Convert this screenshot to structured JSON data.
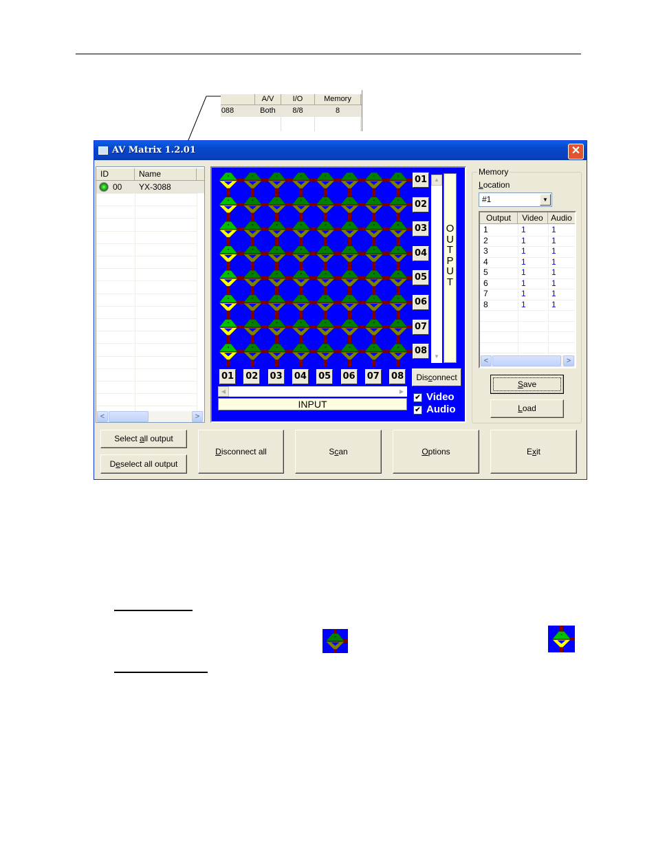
{
  "callout": {
    "columns": [
      "",
      "A/V",
      "I/O",
      "Memory"
    ],
    "row": [
      "088",
      "Both",
      "8/8",
      "8"
    ]
  },
  "window": {
    "title": "AV Matrix 1.2.01",
    "close_icon": "close-icon"
  },
  "device_list": {
    "columns": [
      "ID",
      "Name"
    ],
    "rows": [
      {
        "id": "00",
        "name": "YX-3088",
        "status": "online",
        "status_icon": "green-led-icon"
      }
    ]
  },
  "matrix": {
    "inputs": [
      "01",
      "02",
      "03",
      "04",
      "05",
      "06",
      "07",
      "08"
    ],
    "outputs": [
      "01",
      "02",
      "03",
      "04",
      "05",
      "06",
      "07",
      "08"
    ],
    "connections": [
      {
        "output": "01",
        "input": "01"
      },
      {
        "output": "02",
        "input": "01"
      },
      {
        "output": "03",
        "input": "01"
      },
      {
        "output": "04",
        "input": "01"
      },
      {
        "output": "05",
        "input": "01"
      },
      {
        "output": "06",
        "input": "01"
      },
      {
        "output": "07",
        "input": "01"
      },
      {
        "output": "08",
        "input": "01"
      }
    ],
    "output_label": "OUTPUT",
    "input_label": "INPUT",
    "disconnect_label": "Disconnect",
    "video_label": "Video",
    "video_checked": true,
    "audio_label": "Audio",
    "audio_checked": true,
    "colors": {
      "background": "#0000ff",
      "wire": "#800000",
      "node_connected_top": "#00c000",
      "node_connected_bottom": "#ffff00",
      "node_idle_top": "#008000",
      "node_idle_bottom": "#808000"
    }
  },
  "memory": {
    "group_label": "Memory",
    "location_label": "Location",
    "location_value": "#1",
    "columns": [
      "Output",
      "Video",
      "Audio"
    ],
    "rows": [
      [
        "1",
        "1",
        "1"
      ],
      [
        "2",
        "1",
        "1"
      ],
      [
        "3",
        "1",
        "1"
      ],
      [
        "4",
        "1",
        "1"
      ],
      [
        "5",
        "1",
        "1"
      ],
      [
        "6",
        "1",
        "1"
      ],
      [
        "7",
        "1",
        "1"
      ],
      [
        "8",
        "1",
        "1"
      ]
    ],
    "save_label": "Save",
    "load_label": "Load"
  },
  "buttons": {
    "select_all_output": "Select all output",
    "deselect_all_output": "Deselect all output",
    "disconnect_all": "Disconnect all",
    "scan": "Scan",
    "options": "Options",
    "exit": "Exit"
  },
  "legend_icons": {
    "disconnected": "matrix-node-disconnected-icon",
    "connected": "matrix-node-connected-icon"
  }
}
